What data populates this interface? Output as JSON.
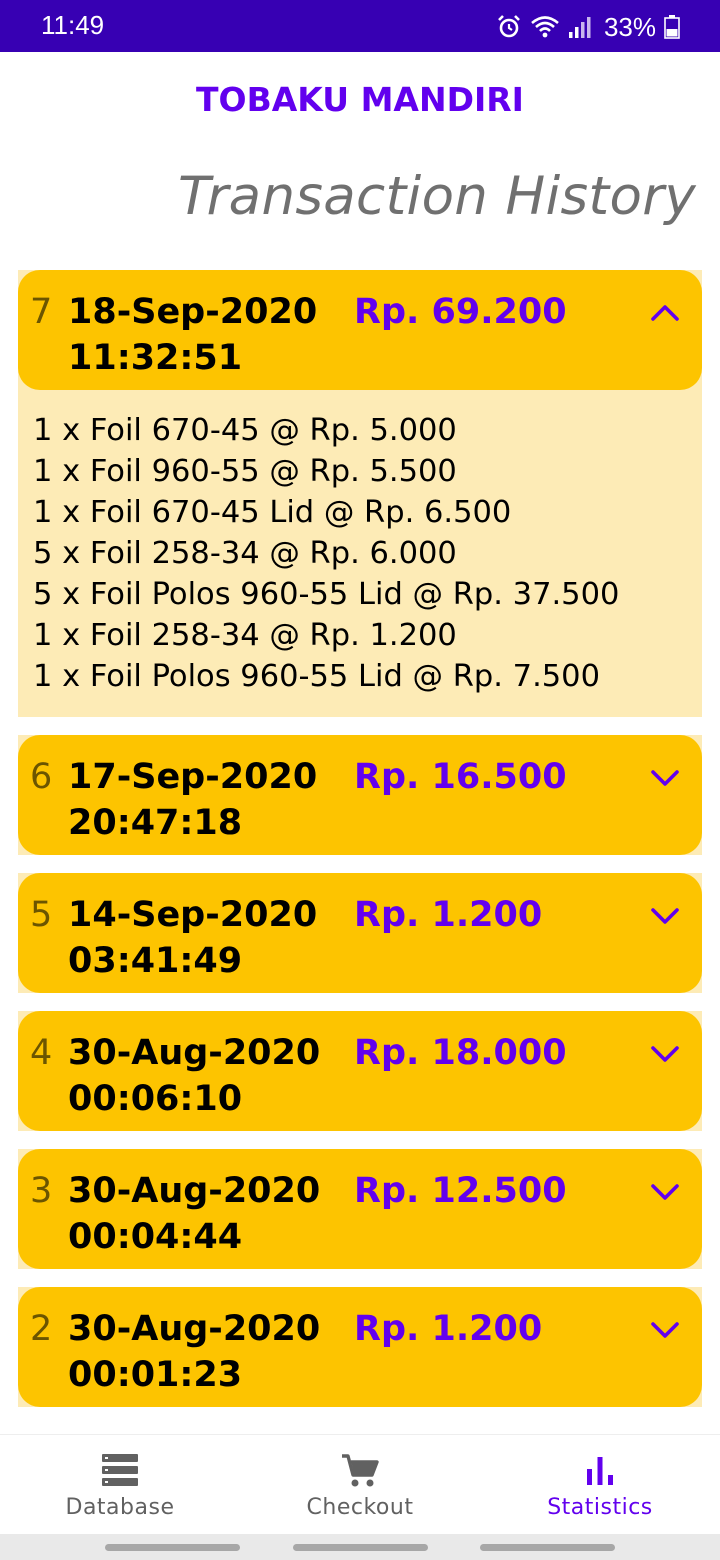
{
  "status_bar": {
    "time": "11:49",
    "battery_percent": "33%",
    "icons": [
      "alarm-icon",
      "wifi-icon",
      "signal-icon",
      "battery-icon"
    ]
  },
  "app": {
    "title": "TOBAKU MANDIRI",
    "page_title": "Transaction History"
  },
  "colors": {
    "status_bar": "#3700b3",
    "accent": "#6200ee",
    "card": "#fdc400",
    "details_bg": "#fdebb6"
  },
  "transactions": [
    {
      "no": "7",
      "date": "18-Sep-2020",
      "time": "11:32:51",
      "amount": "Rp. 69.200",
      "expanded": true,
      "items": [
        "1 x Foil 670-45 @ Rp. 5.000",
        "1 x Foil 960-55 @ Rp. 5.500",
        "1 x Foil 670-45 Lid @ Rp. 6.500",
        "5 x Foil 258-34 @ Rp. 6.000",
        "5 x Foil Polos 960-55 Lid @ Rp. 37.500",
        "1 x Foil 258-34 @ Rp. 1.200",
        "1 x Foil Polos 960-55 Lid @ Rp. 7.500"
      ]
    },
    {
      "no": "6",
      "date": "17-Sep-2020",
      "time": "20:47:18",
      "amount": "Rp. 16.500",
      "expanded": false
    },
    {
      "no": "5",
      "date": "14-Sep-2020",
      "time": "03:41:49",
      "amount": "Rp. 1.200",
      "expanded": false
    },
    {
      "no": "4",
      "date": "30-Aug-2020",
      "time": "00:06:10",
      "amount": "Rp. 18.000",
      "expanded": false
    },
    {
      "no": "3",
      "date": "30-Aug-2020",
      "time": "00:04:44",
      "amount": "Rp. 12.500",
      "expanded": false
    },
    {
      "no": "2",
      "date": "30-Aug-2020",
      "time": "00:01:23",
      "amount": "Rp. 1.200",
      "expanded": false
    }
  ],
  "bottom_nav": {
    "items": [
      {
        "label": "Database",
        "icon": "database-icon",
        "active": false
      },
      {
        "label": "Checkout",
        "icon": "cart-icon",
        "active": false
      },
      {
        "label": "Statistics",
        "icon": "bar-chart-icon",
        "active": true
      }
    ]
  }
}
